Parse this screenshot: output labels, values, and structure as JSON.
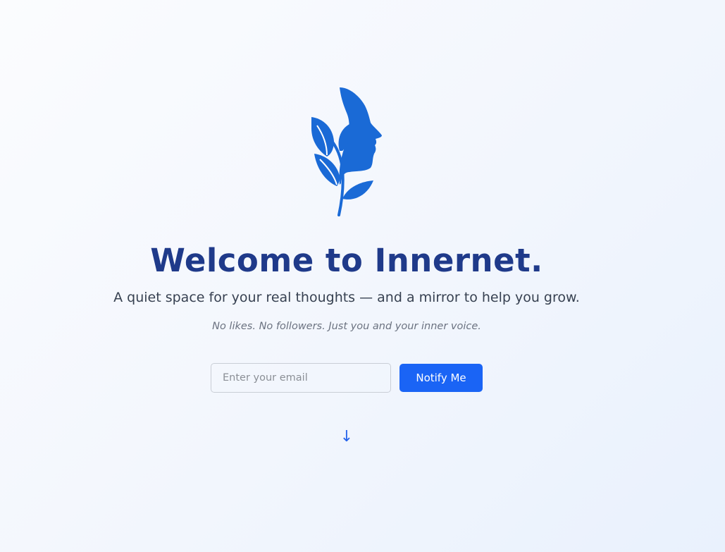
{
  "brand": {
    "logo_icon": "leaf-face-logo-icon",
    "primary_color": "#1a6ad6"
  },
  "hero": {
    "title": "Welcome to Innernet.",
    "tagline": "A quiet space for your real thoughts — and a mirror to help you grow.",
    "subtagline": "No likes. No followers. Just you and your inner voice."
  },
  "signup": {
    "email_placeholder": "Enter your email",
    "email_value": "",
    "button_label": "Notify Me",
    "button_color": "#1a64f5"
  },
  "scroll_hint": {
    "icon": "arrow-down-icon",
    "glyph": "↓"
  },
  "colors": {
    "title": "#1f3a8a",
    "text": "#374151",
    "muted": "#6b7280"
  }
}
